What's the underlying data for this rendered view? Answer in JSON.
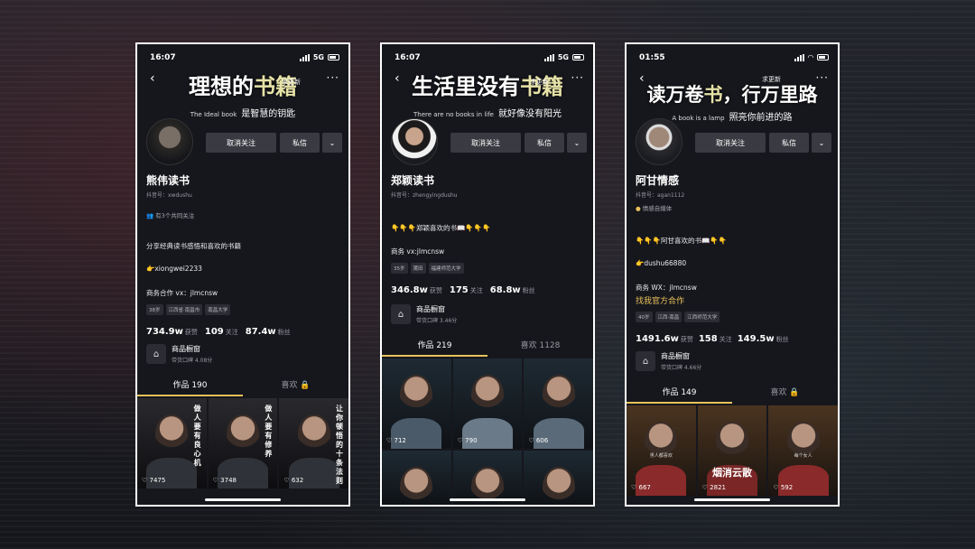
{
  "phones": [
    {
      "time": "16:07",
      "network": "5G",
      "headline_pre": "理想的",
      "headline_hl": "书籍",
      "ask_update": "求更新",
      "sub_en": "The Ideal book",
      "sub_zh": "是智慧的钥匙",
      "follow_btn": "取消关注",
      "msg_btn": "私信",
      "name": "熊伟读书",
      "douyin_id": "抖音号：xwdushu",
      "mutual": "有3个共同关注",
      "bio": "分享经典读书感悟和喜欢的书籍",
      "contact": "👉xiongwei2233",
      "business": "商务合作 vx：jlmcnsw",
      "tags": [
        "38岁",
        "江西省·南昌市",
        "南昌大学"
      ],
      "likes": "734.9w",
      "likes_label": "获赞",
      "following": "109",
      "following_label": "关注",
      "fans": "87.4w",
      "fans_label": "粉丝",
      "shop_title": "商品橱窗",
      "shop_sub": "带货口碑 4.08分",
      "tab_works": "作品 190",
      "tab_likes": "喜欢 🔒",
      "cells": [
        {
          "likes": "♡ 7475",
          "vtext": "做人要有良心机"
        },
        {
          "likes": "♡ 3748",
          "vtext": "做人要有修养"
        },
        {
          "likes": "♡ 632",
          "vtext": "让你顿悟的十条法则"
        }
      ]
    },
    {
      "time": "16:07",
      "network": "5G",
      "headline_pre": "生活里没有",
      "headline_hl": "书籍",
      "ask_update": "求更新",
      "sub_en": "There are no books in life",
      "sub_zh": "就好像没有阳光",
      "follow_btn": "取消关注",
      "msg_btn": "私信",
      "name": "郑颖读书",
      "douyin_id": "抖音号：zhengyingdushu",
      "bio": "👇👇👇郑颖喜欢的书📖👇👇👇",
      "business": "商务 vx:jlmcnsw",
      "tags": [
        "35岁",
        "莆田",
        "福建师范大学"
      ],
      "likes": "346.8w",
      "likes_label": "获赞",
      "following": "175",
      "following_label": "关注",
      "fans": "68.8w",
      "fans_label": "粉丝",
      "shop_title": "商品橱窗",
      "shop_sub": "带货口碑 3.46分",
      "tab_works": "作品 219",
      "tab_likes": "喜欢 1128",
      "cells": [
        {
          "likes": "♡ 712"
        },
        {
          "likes": "♡ 790"
        },
        {
          "likes": "♡ 606"
        },
        {
          "likes": ""
        },
        {
          "likes": ""
        },
        {
          "likes": ""
        }
      ]
    },
    {
      "time": "01:55",
      "network": "",
      "headline_pre": "读万卷",
      "headline_hl": "书",
      "headline_post": "，行万里路",
      "ask_update": "求更新",
      "sub_en": "A book is a lamp",
      "sub_zh": "照亮你前进的路",
      "follow_btn": "取消关注",
      "msg_btn": "私信",
      "name": "阿甘情感",
      "douyin_id": "抖音号：agan1112",
      "badge": "情感自媒体",
      "bio": "👇👇👇阿甘喜欢的书📖👇👇",
      "contact": "👉dushu66880",
      "business": "商务 WX：jlmcnsw",
      "official": "找我官方合作",
      "tags": [
        "40岁",
        "江西·南昌",
        "江西师范大学"
      ],
      "likes": "1491.6w",
      "likes_label": "获赞",
      "following": "158",
      "following_label": "关注",
      "fans": "149.5w",
      "fans_label": "粉丝",
      "shop_title": "商品橱窗",
      "shop_sub": "带货口碑 4.66分",
      "tab_works": "作品 149",
      "tab_likes": "喜欢 🔒",
      "cells": [
        {
          "likes": "♡ 667",
          "cap": "男人都喜欢"
        },
        {
          "likes": "♡ 2821",
          "overlay": "烟消云散"
        },
        {
          "likes": "♡ 592",
          "cap": "每个女人"
        }
      ]
    }
  ]
}
